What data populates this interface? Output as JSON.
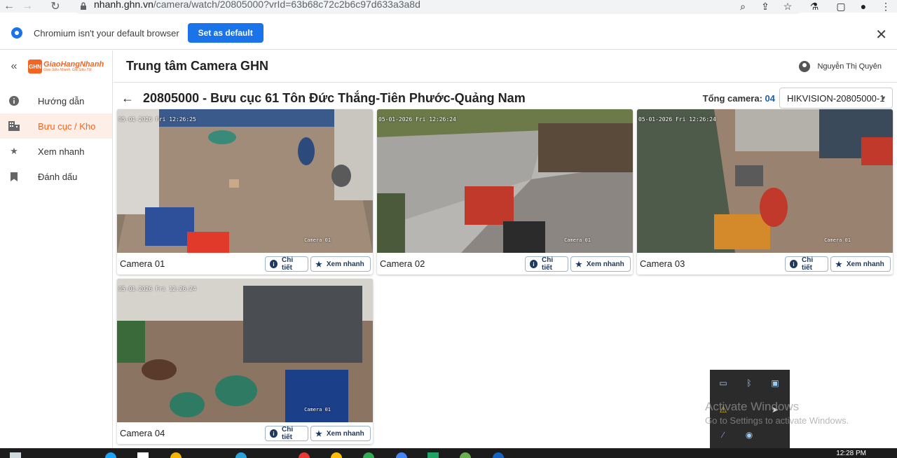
{
  "browser": {
    "url_host": "nhanh.ghn.vn",
    "url_path": "/camera/watch/20805000?vrId=63b68c72c2b6c97d633a3a8d"
  },
  "infobar": {
    "message": "Chromium isn't your default browser",
    "button": "Set as default"
  },
  "app": {
    "logo_mark": "GHN",
    "logo_name": "GiaoHangNhanh",
    "logo_tagline": "Giao Siêu Nhanh, Giá Siêu Tốt",
    "header_title": "Trung tâm Camera GHN",
    "user_name": "Nguyễn Thị Quyên",
    "brand_color": "#f26522"
  },
  "sidebar": {
    "items": [
      {
        "label": "Hướng dẫn",
        "icon": "info-icon"
      },
      {
        "label": "Bưu cục / Kho",
        "icon": "building-icon",
        "active": true
      },
      {
        "label": "Xem nhanh",
        "icon": "star-icon"
      },
      {
        "label": "Đánh dấu",
        "icon": "bookmark-icon"
      }
    ]
  },
  "page": {
    "title": "20805000 - Bưu cục 61 Tôn Đức Thắng-Tiên Phước-Quảng Nam",
    "total_label": "Tổng camera:",
    "total_value": "04",
    "device": "HIKVISION-20805000-1"
  },
  "cameras": [
    {
      "name": "Camera 01",
      "timestamp": "05-01-2026 Fri 12:26:25",
      "overlay": "Camera 01",
      "detail": "Chi tiết",
      "quick": "Xem nhanh"
    },
    {
      "name": "Camera 02",
      "timestamp": "05-01-2026 Fri 12:26:24",
      "overlay": "Camera 01",
      "detail": "Chi tiết",
      "quick": "Xem nhanh"
    },
    {
      "name": "Camera 03",
      "timestamp": "05-01-2026 Fri 12:26:24",
      "overlay": "Camera 01",
      "detail": "Chi tiết",
      "quick": "Xem nhanh"
    },
    {
      "name": "Camera 04",
      "timestamp": "05-01-2026 Fri 12:26:24",
      "overlay": "Camera 01",
      "detail": "Chi tiết",
      "quick": "Xem nhanh"
    }
  ],
  "watermark": {
    "line1": "Activate Windows",
    "line2": "Go to Settings to activate Windows."
  },
  "taskbar": {
    "clock": "12:28 PM"
  }
}
